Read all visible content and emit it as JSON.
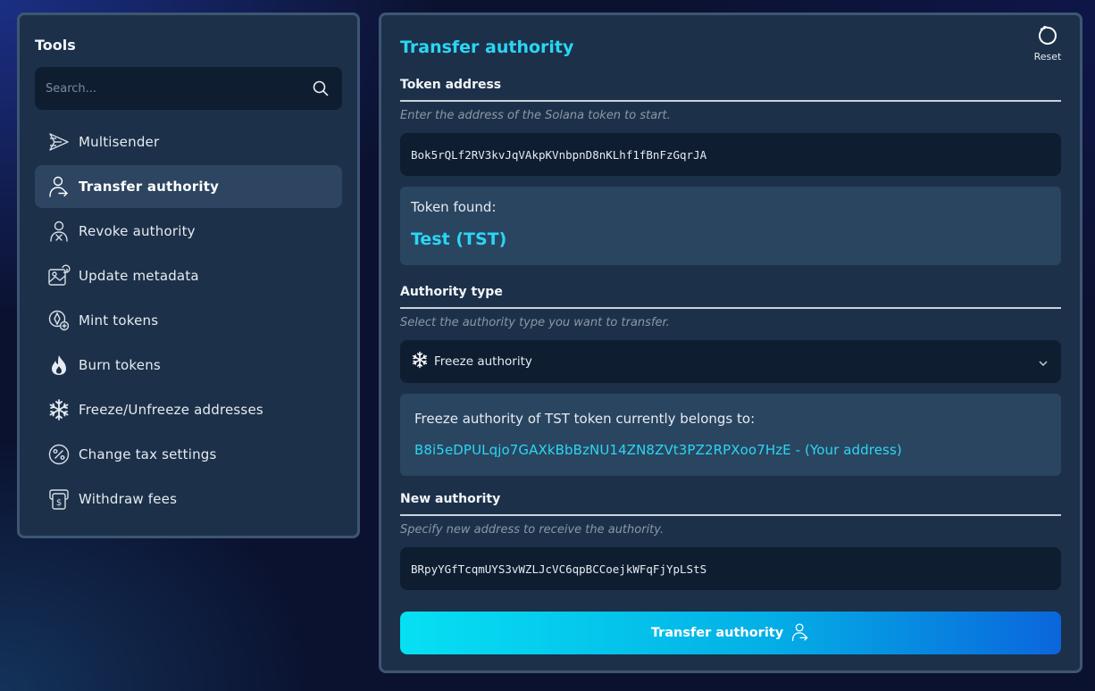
{
  "sidebar": {
    "title": "Tools",
    "search_placeholder": "Search...",
    "items": [
      {
        "label": "Multisender",
        "icon": "send-icon"
      },
      {
        "label": "Transfer authority",
        "icon": "user-arrow-icon",
        "active": true
      },
      {
        "label": "Revoke authority",
        "icon": "user-x-icon"
      },
      {
        "label": "Update metadata",
        "icon": "image-edit-icon"
      },
      {
        "label": "Mint tokens",
        "icon": "mint-icon"
      },
      {
        "label": "Burn tokens",
        "icon": "flame-icon"
      },
      {
        "label": "Freeze/Unfreeze addresses",
        "icon": "snowflake-icon"
      },
      {
        "label": "Change tax settings",
        "icon": "percent-icon"
      },
      {
        "label": "Withdraw fees",
        "icon": "dollar-icon"
      }
    ]
  },
  "main": {
    "title": "Transfer authority",
    "reset_label": "Reset",
    "token_section": {
      "label": "Token address",
      "hint": "Enter the address of the Solana token to start.",
      "value": "Bok5rQLf2RV3kvJqVAkpKVnbpnD8nKLhf1fBnFzGqrJA"
    },
    "token_found": {
      "label": "Token found:",
      "value": "Test (TST)"
    },
    "authority_section": {
      "label": "Authority type",
      "hint": "Select the authority type you want to transfer.",
      "selected": "Freeze authority"
    },
    "current_owner": {
      "label": "Freeze authority of TST token currently belongs to:",
      "value": "B8i5eDPULqjo7GAXkBbBzNU14ZN8ZVt3PZ2RPXoo7HzE - (Your address)"
    },
    "new_authority_section": {
      "label": "New authority",
      "hint": "Specify new address to receive the authority.",
      "value": "BRpyYGfTcqmUYS3vWZLJcVC6qpBCCoejkWFqFjYpLStS"
    },
    "submit_label": "Transfer authority"
  },
  "colors": {
    "accent": "#2ad6f4",
    "panel_bg": "#1c3149",
    "input_bg": "#0e1d30",
    "button_gradient_start": "#06e0f3",
    "button_gradient_end": "#0a66dc"
  }
}
